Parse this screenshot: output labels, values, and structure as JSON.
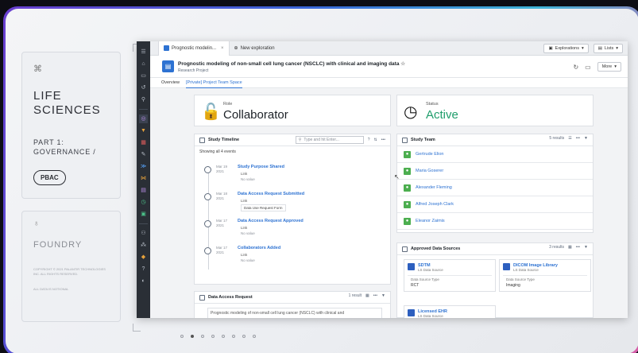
{
  "slide": {
    "top_panel": {
      "title": "LIFE SCIENCES",
      "part": "PART 1: GOVERNANCE /",
      "pill": "PBAC"
    },
    "bottom_panel": {
      "title": "FOUNDRY",
      "meta": "COPYRIGHT © 2021 PALANTIR TECHNOLOGIES INC. ALL RIGHTS RESERVED.",
      "meta2": "ALL DATA IS NOTIONAL"
    },
    "page_dots": 8,
    "active_dot": 1
  },
  "tabs": [
    {
      "label": "Prognostic modelin...",
      "active": true
    },
    {
      "label": "New exploration",
      "active": false
    }
  ],
  "toolbar": {
    "explorations_label": "Explorations",
    "lists_label": "Lists"
  },
  "project": {
    "title": "Prognostic modeling of non-small cell lung cancer (NSCLC) with clinical and imaging data",
    "subtitle": "Research Project",
    "more_label": "More"
  },
  "subnav": [
    {
      "label": "Overview",
      "active": false
    },
    {
      "label": "[Private] Project Team Space",
      "active": true
    }
  ],
  "role": {
    "label": "Role",
    "value": "Collaborator"
  },
  "status": {
    "label": "Status",
    "value": "Active",
    "color": "#1f9d6b"
  },
  "timeline": {
    "title": "Study Timeline",
    "search_placeholder": "Type and hit Enter...",
    "showing": "Showing all 4 events",
    "events": [
      {
        "date": "Mar 19 2021",
        "title": "Study Purpose Shared",
        "link": "Link",
        "value": "No value"
      },
      {
        "date": "Mar 18 2021",
        "title": "Data Access Request Submitted",
        "link": "Link",
        "value": "Data Use Request Form"
      },
      {
        "date": "Mar 17 2021",
        "title": "Data Access Request Approved",
        "link": "Link",
        "value": "No value"
      },
      {
        "date": "Mar 17 2021",
        "title": "Collaborators Added",
        "link": "Link",
        "value": "No value"
      }
    ]
  },
  "team": {
    "title": "Study Team",
    "count": "5 results",
    "members": [
      "Gertrude Elion",
      "Maria Goserer",
      "Alexander Fleming",
      "Alfred Joseph Clark",
      "Eleanor Zaimis"
    ]
  },
  "sources": {
    "title": "Approved Data Sources",
    "count": "3 results",
    "items": [
      {
        "name": "SDTM",
        "type": "LS Data Source",
        "field": "Data Source Type",
        "value": "RCT"
      },
      {
        "name": "DICOM Image Library",
        "type": "LS Data Source",
        "field": "Data Source Type",
        "value": "Imaging"
      },
      {
        "name": "Licensed EHR",
        "type": "LS Data Source",
        "field": "",
        "value": ""
      }
    ]
  },
  "dar": {
    "title": "Data Access Request",
    "count": "1 result",
    "preview": "Prognostic modeling of non-small cell lung cancer (NSCLC) with clinical and"
  }
}
